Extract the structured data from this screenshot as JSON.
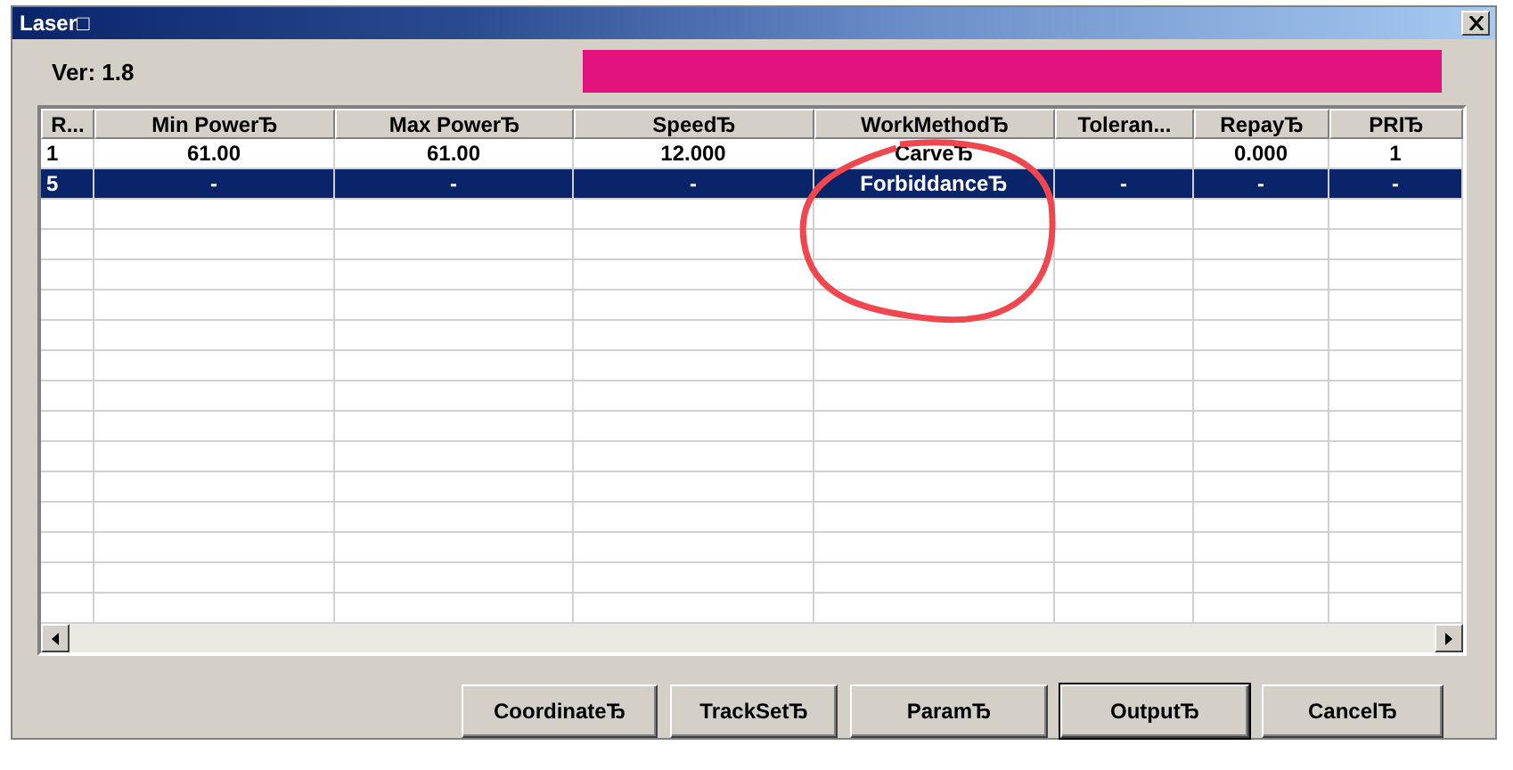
{
  "window": {
    "title": "Laser□"
  },
  "version": "Ver: 1.8",
  "table": {
    "columns": [
      "R...",
      "Min PowerЂ",
      "Max PowerЂ",
      "SpeedЂ",
      "WorkMethodЂ",
      "Toleran...",
      "RepayЂ",
      "PRIЂ"
    ],
    "rows": [
      {
        "cells": [
          "1",
          "61.00",
          "61.00",
          "12.000",
          "CarveЂ",
          "",
          "0.000",
          "1"
        ],
        "selected": false
      },
      {
        "cells": [
          "5",
          "-",
          "-",
          "-",
          "ForbiddanceЂ",
          "-",
          "-",
          "-"
        ],
        "selected": true
      }
    ]
  },
  "buttons": [
    {
      "label": "CoordinateЂ",
      "default": false
    },
    {
      "label": "TrackSetЂ",
      "default": false
    },
    {
      "label": "ParamЂ",
      "default": false
    },
    {
      "label": "OutputЂ",
      "default": true
    },
    {
      "label": "CancelЂ",
      "default": false
    }
  ]
}
